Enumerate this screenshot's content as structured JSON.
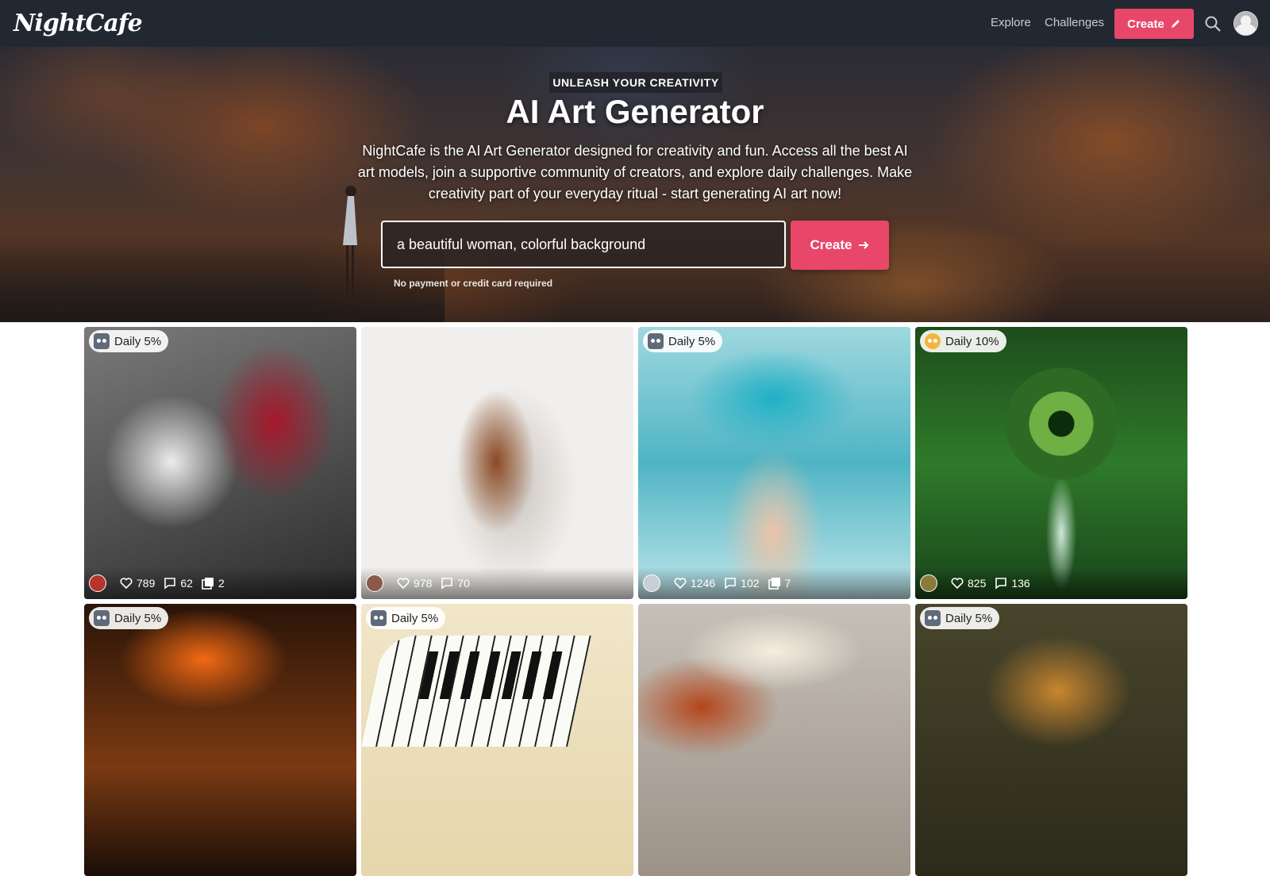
{
  "navbar": {
    "logo": "NightCafe",
    "links": [
      "Explore",
      "Challenges"
    ],
    "create_label": "Create"
  },
  "hero": {
    "eyebrow": "UNLEASH YOUR CREATIVITY",
    "title": "AI Art Generator",
    "description": "NightCafe is the AI Art Generator designed for creativity and fun. Access all the best AI art models, join a supportive community of creators, and explore daily challenges. Make creativity part of your everyday ritual - start generating AI art now!",
    "prompt_value": "a beautiful woman, colorful background",
    "create_label": "Create",
    "note": "No payment or credit card required"
  },
  "gallery": {
    "cards": [
      {
        "badge": "Daily 5%",
        "likes": "789",
        "comments": "62",
        "images": "2"
      },
      {
        "badge": "",
        "likes": "978",
        "comments": "70",
        "images": ""
      },
      {
        "badge": "Daily 5%",
        "likes": "1246",
        "comments": "102",
        "images": "7"
      },
      {
        "badge": "Daily 10%",
        "likes": "825",
        "comments": "136",
        "images": ""
      },
      {
        "badge": "Daily 5%"
      },
      {
        "badge": "Daily 5%"
      },
      {
        "badge": ""
      },
      {
        "badge": "Daily 5%"
      }
    ]
  },
  "colors": {
    "navbar_bg": "#222831",
    "accent": "#e8476a"
  },
  "icons": [
    "pencil-icon",
    "search-icon",
    "arrow-right-icon",
    "robot-icon",
    "heart-icon",
    "comment-icon",
    "image-stack-icon"
  ]
}
